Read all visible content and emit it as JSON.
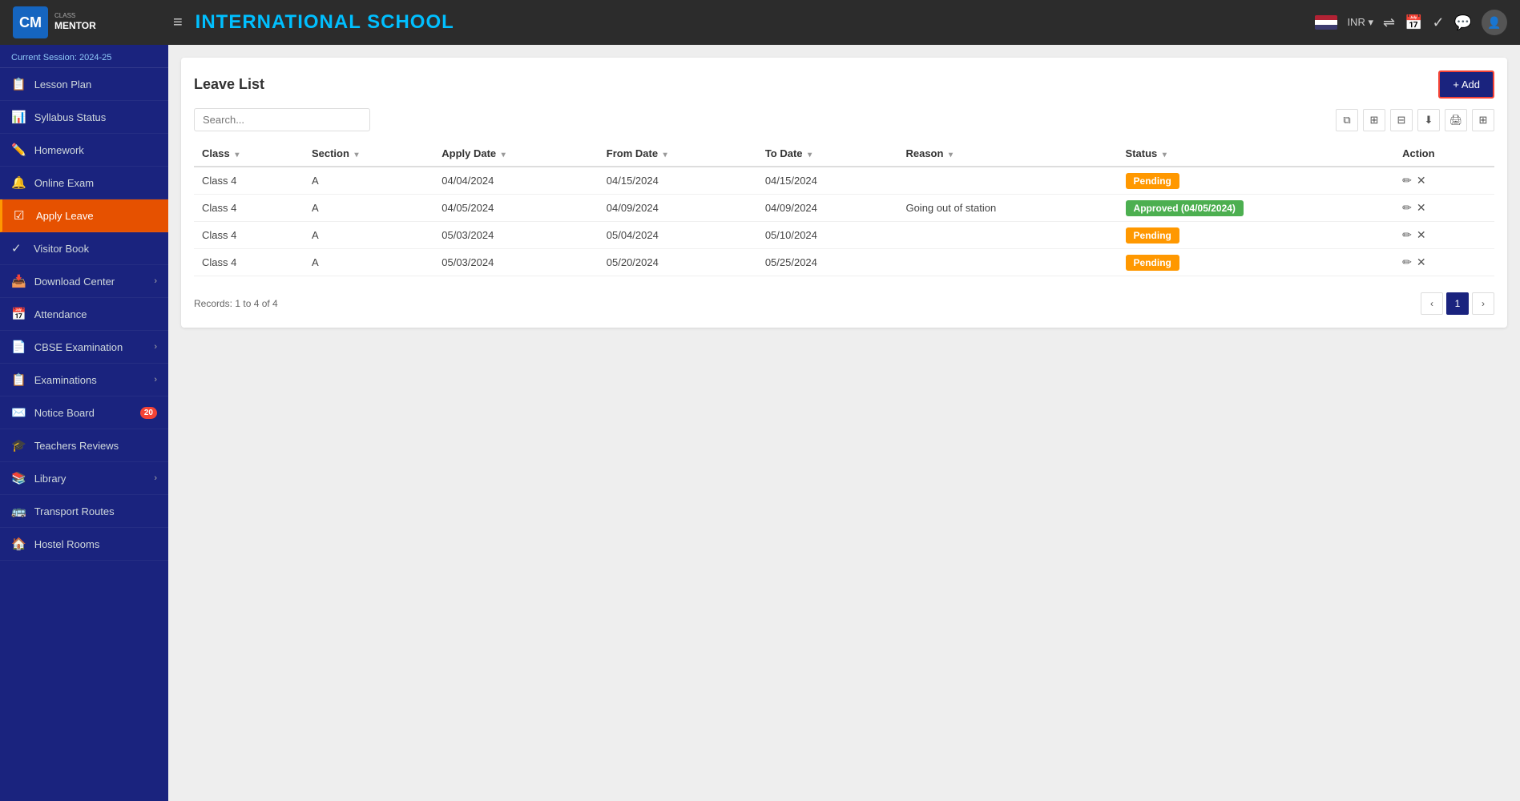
{
  "topbar": {
    "logo_cm": "CM",
    "logo_class": "CLASS",
    "logo_mentor": "MENTOR",
    "school_title": "INTERNATIONAL SCHOOL",
    "currency": "INR ▾",
    "hamburger": "≡"
  },
  "sidebar": {
    "session_label": "Current Session: 2024-25",
    "items": [
      {
        "id": "lesson-plan",
        "label": "Lesson Plan",
        "icon": "📋",
        "active": false
      },
      {
        "id": "syllabus-status",
        "label": "Syllabus Status",
        "icon": "📊",
        "active": false
      },
      {
        "id": "homework",
        "label": "Homework",
        "icon": "✏️",
        "active": false
      },
      {
        "id": "online-exam",
        "label": "Online Exam",
        "icon": "🔔",
        "active": false
      },
      {
        "id": "apply-leave",
        "label": "Apply Leave",
        "icon": "☑",
        "active": true
      },
      {
        "id": "visitor-book",
        "label": "Visitor Book",
        "icon": "✓",
        "active": false
      },
      {
        "id": "download-center",
        "label": "Download Center",
        "icon": "📥",
        "active": false,
        "has_arrow": true
      },
      {
        "id": "attendance",
        "label": "Attendance",
        "icon": "📅",
        "active": false
      },
      {
        "id": "cbse-examination",
        "label": "CBSE Examination",
        "icon": "📄",
        "active": false,
        "has_arrow": true
      },
      {
        "id": "examinations",
        "label": "Examinations",
        "icon": "📋",
        "active": false,
        "has_arrow": true
      },
      {
        "id": "notice-board",
        "label": "Notice Board",
        "icon": "✉️",
        "active": false,
        "badge": "20"
      },
      {
        "id": "teachers-reviews",
        "label": "Teachers Reviews",
        "icon": "🎓",
        "active": false
      },
      {
        "id": "library",
        "label": "Library",
        "icon": "📚",
        "active": false,
        "has_arrow": true
      },
      {
        "id": "transport-routes",
        "label": "Transport Routes",
        "icon": "🚌",
        "active": false
      },
      {
        "id": "hostel-rooms",
        "label": "Hostel Rooms",
        "icon": "🏠",
        "active": false
      }
    ]
  },
  "page": {
    "title": "Leave List",
    "add_button": "+ Add",
    "search_placeholder": "Search...",
    "records_info": "Records: 1 to 4 of 4"
  },
  "table": {
    "columns": [
      {
        "key": "class",
        "label": "Class"
      },
      {
        "key": "section",
        "label": "Section"
      },
      {
        "key": "apply_date",
        "label": "Apply Date"
      },
      {
        "key": "from_date",
        "label": "From Date"
      },
      {
        "key": "to_date",
        "label": "To Date"
      },
      {
        "key": "reason",
        "label": "Reason"
      },
      {
        "key": "status",
        "label": "Status"
      },
      {
        "key": "action",
        "label": "Action"
      }
    ],
    "rows": [
      {
        "class": "Class 4",
        "section": "A",
        "apply_date": "04/04/2024",
        "from_date": "04/15/2024",
        "to_date": "04/15/2024",
        "reason": "",
        "status": "Pending",
        "status_type": "pending"
      },
      {
        "class": "Class 4",
        "section": "A",
        "apply_date": "04/05/2024",
        "from_date": "04/09/2024",
        "to_date": "04/09/2024",
        "reason": "Going out of station",
        "status": "Approved (04/05/2024)",
        "status_type": "approved"
      },
      {
        "class": "Class 4",
        "section": "A",
        "apply_date": "05/03/2024",
        "from_date": "05/04/2024",
        "to_date": "05/10/2024",
        "reason": "",
        "status": "Pending",
        "status_type": "pending"
      },
      {
        "class": "Class 4",
        "section": "A",
        "apply_date": "05/03/2024",
        "from_date": "05/20/2024",
        "to_date": "05/25/2024",
        "reason": "",
        "status": "Pending",
        "status_type": "pending"
      }
    ]
  },
  "pagination": {
    "current": "1",
    "prev": "‹",
    "next": "›"
  }
}
